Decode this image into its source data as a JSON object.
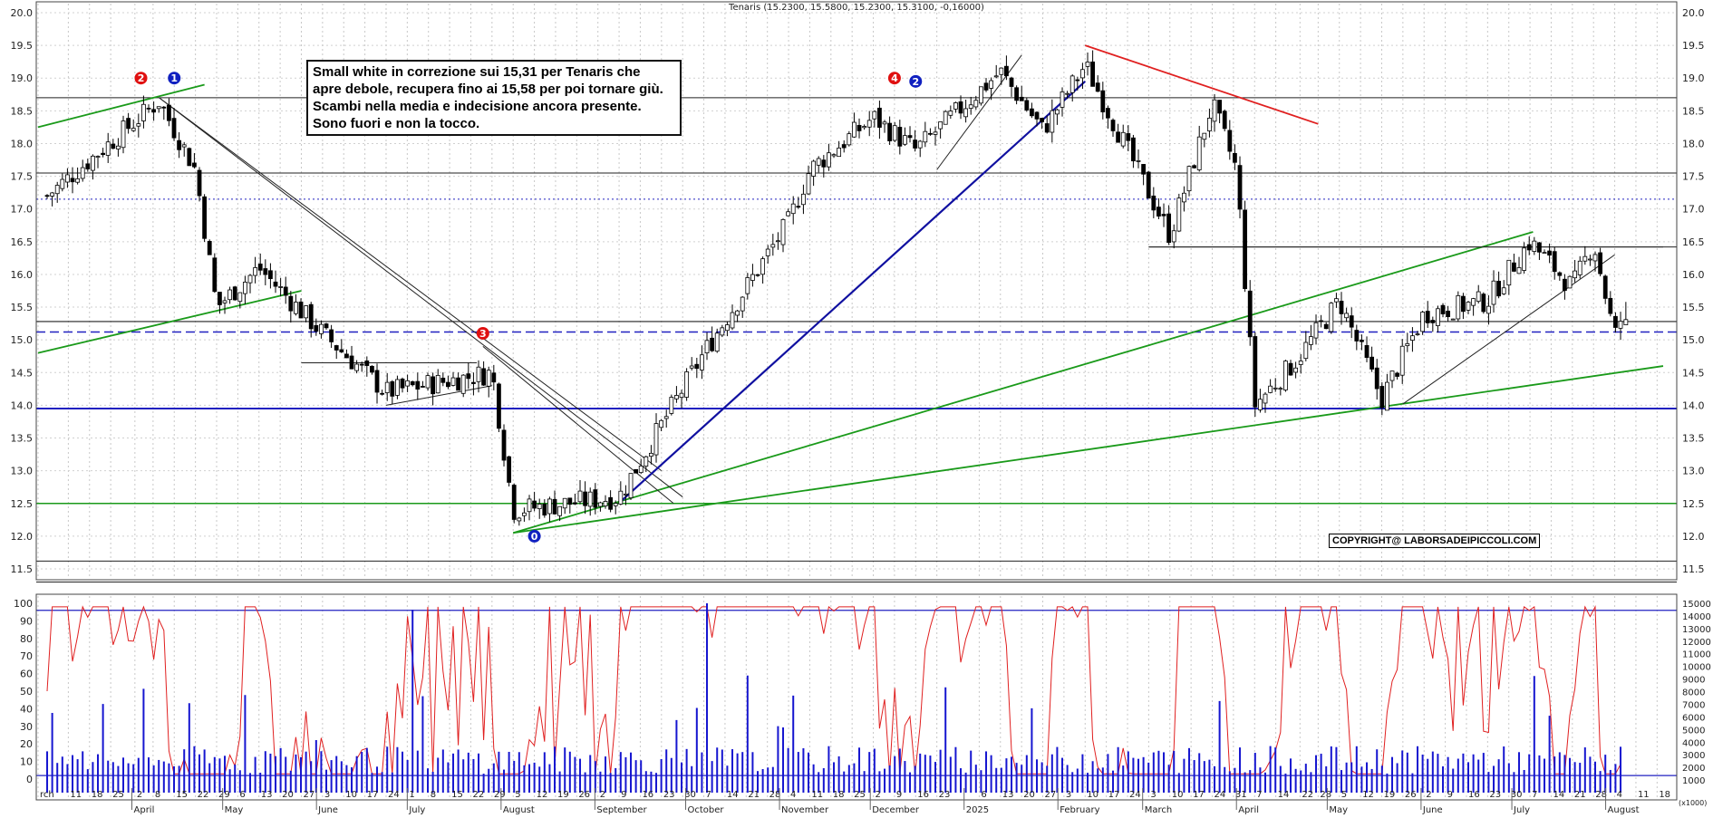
{
  "header": {
    "title": "Tenaris (15.2300, 15.5800, 15.2300, 15.3100, -0,16000)"
  },
  "note": {
    "lines": [
      "Small white in correzione sui 15,31 per Tenaris che",
      "apre debole, recupera fino ai 15,58 per poi tornare giù.",
      "Scambi nella media e indecisione ancora presente.",
      "Sono fuori e non la tocco."
    ]
  },
  "copyright": "COPYRIGHT@ LABORSADEIPICCOLI.COM",
  "colors": {
    "price_up": "#ffffff",
    "price_down": "#000000",
    "trend_green": "#1a9a1a",
    "trend_blue": "#1010a0",
    "trend_red": "#e02020",
    "oscillator": "#e02020",
    "volume": "#1515d0"
  },
  "chart_data": [
    {
      "type": "candlestick",
      "title": "Tenaris (15.2300, 15.5800, 15.2300, 15.3100, -0,16000)",
      "ylim": [
        11.5,
        20.0
      ],
      "y_ticks": [
        "20.0",
        "19.5",
        "19.0",
        "18.5",
        "18.0",
        "17.5",
        "17.0",
        "16.5",
        "16.0",
        "15.5",
        "15.0",
        "14.5",
        "14.0",
        "13.5",
        "13.0",
        "12.5",
        "12.0",
        "11.5"
      ],
      "last_bar": {
        "open": 15.23,
        "high": 15.58,
        "low": 15.23,
        "close": 15.31,
        "change": -0.16
      },
      "horizontal_levels": [
        18.7,
        17.55,
        17.15,
        16.42,
        15.28,
        15.12,
        13.95,
        12.5,
        11.62
      ],
      "wave_labels": [
        {
          "text": "2",
          "color": "red",
          "date": "2024-04-04",
          "price": 19.0
        },
        {
          "text": "1",
          "color": "blue",
          "date": "2024-04-15",
          "price": 19.0
        },
        {
          "text": "3",
          "color": "red",
          "date": "2024-07-26",
          "price": 15.1
        },
        {
          "text": "0",
          "color": "blue",
          "date": "2024-08-12",
          "price": 12.0
        },
        {
          "text": "4",
          "color": "red",
          "date": "2024-12-09",
          "price": 19.0
        },
        {
          "text": "2",
          "color": "blue",
          "date": "2024-12-16",
          "price": 18.95
        }
      ],
      "key_points": [
        {
          "date": "2024-03-04",
          "close": 17.2
        },
        {
          "date": "2024-04-10",
          "close": 18.65
        },
        {
          "date": "2024-04-22",
          "close": 17.6
        },
        {
          "date": "2024-04-29",
          "close": 15.5
        },
        {
          "date": "2024-05-13",
          "close": 16.1
        },
        {
          "date": "2024-06-03",
          "close": 15.1
        },
        {
          "date": "2024-06-24",
          "close": 14.2
        },
        {
          "date": "2024-07-29",
          "close": 14.5
        },
        {
          "date": "2024-08-05",
          "close": 12.4
        },
        {
          "date": "2024-09-09",
          "close": 12.6
        },
        {
          "date": "2024-10-07",
          "close": 14.8
        },
        {
          "date": "2024-11-04",
          "close": 16.8
        },
        {
          "date": "2024-11-11",
          "close": 17.6
        },
        {
          "date": "2024-12-02",
          "close": 18.4
        },
        {
          "date": "2024-12-16",
          "close": 17.9
        },
        {
          "date": "2025-01-13",
          "close": 19.1
        },
        {
          "date": "2025-01-27",
          "close": 18.2
        },
        {
          "date": "2025-02-10",
          "close": 19.2
        },
        {
          "date": "2025-03-10",
          "close": 16.6
        },
        {
          "date": "2025-03-24",
          "close": 18.6
        },
        {
          "date": "2025-04-01",
          "close": 17.6
        },
        {
          "date": "2025-04-07",
          "close": 14.0
        },
        {
          "date": "2025-04-21",
          "close": 14.7
        },
        {
          "date": "2025-05-05",
          "close": 15.6
        },
        {
          "date": "2025-05-19",
          "close": 14.1
        },
        {
          "date": "2025-06-02",
          "close": 15.4
        },
        {
          "date": "2025-06-23",
          "close": 15.6
        },
        {
          "date": "2025-07-07",
          "close": 16.5
        },
        {
          "date": "2025-07-21",
          "close": 15.8
        },
        {
          "date": "2025-07-28",
          "close": 16.5
        },
        {
          "date": "2025-08-04",
          "close": 15.05
        },
        {
          "date": "2025-08-06",
          "close": 15.31
        }
      ]
    },
    {
      "type": "line",
      "series": [
        {
          "name": "",
          "values_note": "oscillator 0-100"
        }
      ],
      "ylim": [
        0,
        100
      ],
      "y_ticks": [
        "100",
        "90",
        "80",
        "70",
        "60",
        "50",
        "40",
        "30",
        "20",
        "10",
        "0"
      ],
      "levels": [
        96,
        2
      ]
    },
    {
      "type": "bar",
      "ylabel": "(x1000)",
      "ylim": [
        0,
        15000
      ],
      "y_ticks": [
        "15000",
        "14000",
        "13000",
        "12000",
        "11000",
        "10000",
        "9000",
        "8000",
        "7000",
        "6000",
        "5000",
        "4000",
        "3000",
        "2000",
        "1000"
      ]
    }
  ],
  "x_axis": {
    "labels": [
      {
        "t": "rch",
        "d": "2024-03-01"
      },
      {
        "t": "11",
        "d": "2024-03-11"
      },
      {
        "t": "18",
        "d": "2024-03-18"
      },
      {
        "t": "25",
        "d": "2024-03-25"
      },
      {
        "t": "2",
        "d": "2024-04-02"
      },
      {
        "t": "8",
        "d": "2024-04-08"
      },
      {
        "t": "15",
        "d": "2024-04-15"
      },
      {
        "t": "22",
        "d": "2024-04-22"
      },
      {
        "t": "29",
        "d": "2024-04-29"
      },
      {
        "t": "6",
        "d": "2024-05-06"
      },
      {
        "t": "13",
        "d": "2024-05-13"
      },
      {
        "t": "20",
        "d": "2024-05-20"
      },
      {
        "t": "27",
        "d": "2024-05-27"
      },
      {
        "t": "3",
        "d": "2024-06-03"
      },
      {
        "t": "10",
        "d": "2024-06-10"
      },
      {
        "t": "17",
        "d": "2024-06-17"
      },
      {
        "t": "24",
        "d": "2024-06-24"
      },
      {
        "t": "1",
        "d": "2024-07-01"
      },
      {
        "t": "8",
        "d": "2024-07-08"
      },
      {
        "t": "15",
        "d": "2024-07-15"
      },
      {
        "t": "22",
        "d": "2024-07-22"
      },
      {
        "t": "29",
        "d": "2024-07-29"
      },
      {
        "t": "5",
        "d": "2024-08-05"
      },
      {
        "t": "12",
        "d": "2024-08-12"
      },
      {
        "t": "19",
        "d": "2024-08-19"
      },
      {
        "t": "26",
        "d": "2024-08-26"
      },
      {
        "t": "2",
        "d": "2024-09-02"
      },
      {
        "t": "9",
        "d": "2024-09-09"
      },
      {
        "t": "16",
        "d": "2024-09-16"
      },
      {
        "t": "23",
        "d": "2024-09-23"
      },
      {
        "t": "30",
        "d": "2024-09-30"
      },
      {
        "t": "7",
        "d": "2024-10-07"
      },
      {
        "t": "14",
        "d": "2024-10-14"
      },
      {
        "t": "21",
        "d": "2024-10-21"
      },
      {
        "t": "28",
        "d": "2024-10-28"
      },
      {
        "t": "4",
        "d": "2024-11-04"
      },
      {
        "t": "11",
        "d": "2024-11-11"
      },
      {
        "t": "18",
        "d": "2024-11-18"
      },
      {
        "t": "25",
        "d": "2024-11-25"
      },
      {
        "t": "2",
        "d": "2024-12-02"
      },
      {
        "t": "9",
        "d": "2024-12-09"
      },
      {
        "t": "16",
        "d": "2024-12-16"
      },
      {
        "t": "23",
        "d": "2024-12-23"
      },
      {
        "t": "6",
        "d": "2025-01-06"
      },
      {
        "t": "13",
        "d": "2025-01-13"
      },
      {
        "t": "20",
        "d": "2025-01-20"
      },
      {
        "t": "27",
        "d": "2025-01-27"
      },
      {
        "t": "3",
        "d": "2025-02-03"
      },
      {
        "t": "10",
        "d": "2025-02-10"
      },
      {
        "t": "17",
        "d": "2025-02-17"
      },
      {
        "t": "24",
        "d": "2025-02-24"
      },
      {
        "t": "3",
        "d": "2025-03-03"
      },
      {
        "t": "10",
        "d": "2025-03-10"
      },
      {
        "t": "17",
        "d": "2025-03-17"
      },
      {
        "t": "24",
        "d": "2025-03-24"
      },
      {
        "t": "31",
        "d": "2025-03-31"
      },
      {
        "t": "7",
        "d": "2025-04-07"
      },
      {
        "t": "14",
        "d": "2025-04-14"
      },
      {
        "t": "22",
        "d": "2025-04-22"
      },
      {
        "t": "28",
        "d": "2025-04-28"
      },
      {
        "t": "5",
        "d": "2025-05-05"
      },
      {
        "t": "12",
        "d": "2025-05-12"
      },
      {
        "t": "19",
        "d": "2025-05-19"
      },
      {
        "t": "26",
        "d": "2025-05-26"
      },
      {
        "t": "2",
        "d": "2025-06-02"
      },
      {
        "t": "9",
        "d": "2025-06-09"
      },
      {
        "t": "16",
        "d": "2025-06-16"
      },
      {
        "t": "23",
        "d": "2025-06-23"
      },
      {
        "t": "30",
        "d": "2025-06-30"
      },
      {
        "t": "7",
        "d": "2025-07-07"
      },
      {
        "t": "14",
        "d": "2025-07-14"
      },
      {
        "t": "21",
        "d": "2025-07-21"
      },
      {
        "t": "28",
        "d": "2025-07-28"
      },
      {
        "t": "4",
        "d": "2025-08-04"
      },
      {
        "t": "11",
        "d": "2025-08-11"
      },
      {
        "t": "18",
        "d": "2025-08-18"
      }
    ],
    "months": [
      {
        "t": "April",
        "d": "2024-04-01"
      },
      {
        "t": "May",
        "d": "2024-05-01"
      },
      {
        "t": "June",
        "d": "2024-06-01"
      },
      {
        "t": "July",
        "d": "2024-07-01"
      },
      {
        "t": "August",
        "d": "2024-08-01"
      },
      {
        "t": "September",
        "d": "2024-09-01"
      },
      {
        "t": "October",
        "d": "2024-10-01"
      },
      {
        "t": "November",
        "d": "2024-11-01"
      },
      {
        "t": "December",
        "d": "2024-12-01"
      },
      {
        "t": "2025",
        "d": "2025-01-01"
      },
      {
        "t": "February",
        "d": "2025-02-01"
      },
      {
        "t": "March",
        "d": "2025-03-01"
      },
      {
        "t": "April",
        "d": "2025-04-01"
      },
      {
        "t": "May",
        "d": "2025-05-01"
      },
      {
        "t": "June",
        "d": "2025-06-01"
      },
      {
        "t": "July",
        "d": "2025-07-01"
      },
      {
        "t": "August",
        "d": "2025-08-01"
      }
    ]
  },
  "trendlines": [
    {
      "name": "green-upper-left",
      "color": "green",
      "p1": [
        "2024-03-01",
        18.25
      ],
      "p2": [
        "2024-04-25",
        18.9
      ]
    },
    {
      "name": "green-support-left",
      "color": "green",
      "p1": [
        "2024-03-01",
        14.8
      ],
      "p2": [
        "2024-05-27",
        15.75
      ]
    },
    {
      "name": "green-main-channel",
      "color": "green",
      "p1": [
        "2024-08-05",
        12.05
      ],
      "p2": [
        "2025-07-08",
        16.65
      ]
    },
    {
      "name": "green-lower-channel",
      "color": "green",
      "p1": [
        "2024-08-05",
        12.05
      ],
      "p2": [
        "2025-08-20",
        14.6
      ]
    },
    {
      "name": "black-down-1",
      "color": "black",
      "p1": [
        "2024-04-10",
        18.7
      ],
      "p2": [
        "2024-09-30",
        12.6
      ]
    },
    {
      "name": "black-down-2",
      "color": "black",
      "p1": [
        "2024-04-10",
        18.7
      ],
      "p2": [
        "2024-09-23",
        13.0
      ]
    },
    {
      "name": "black-down-3",
      "color": "black",
      "p1": [
        "2024-07-26",
        14.9
      ],
      "p2": [
        "2024-09-27",
        12.5
      ]
    },
    {
      "name": "blue-uptrend",
      "color": "blue",
      "p1": [
        "2024-09-10",
        12.55
      ],
      "p2": [
        "2025-02-10",
        18.95
      ]
    },
    {
      "name": "black-up-dec",
      "color": "black",
      "p1": [
        "2024-12-23",
        17.6
      ],
      "p2": [
        "2025-01-20",
        19.35
      ]
    },
    {
      "name": "red-down-2025",
      "color": "red",
      "p1": [
        "2025-02-10",
        19.5
      ],
      "p2": [
        "2025-04-28",
        18.3
      ]
    },
    {
      "name": "black-up-2025",
      "color": "black",
      "p1": [
        "2025-05-26",
        14.02
      ],
      "p2": [
        "2025-08-04",
        16.3
      ]
    },
    {
      "name": "black-base-july",
      "color": "black",
      "p1": [
        "2024-05-27",
        14.65
      ],
      "p2": [
        "2024-07-24",
        14.65
      ]
    },
    {
      "name": "black-flag-july",
      "color": "black",
      "p1": [
        "2024-06-24",
        14.0
      ],
      "p2": [
        "2024-07-29",
        14.3
      ]
    },
    {
      "name": "black-support-mar",
      "color": "black",
      "p1": [
        "2025-03-03",
        16.42
      ],
      "p2": [
        "2025-08-20",
        16.42
      ]
    }
  ]
}
